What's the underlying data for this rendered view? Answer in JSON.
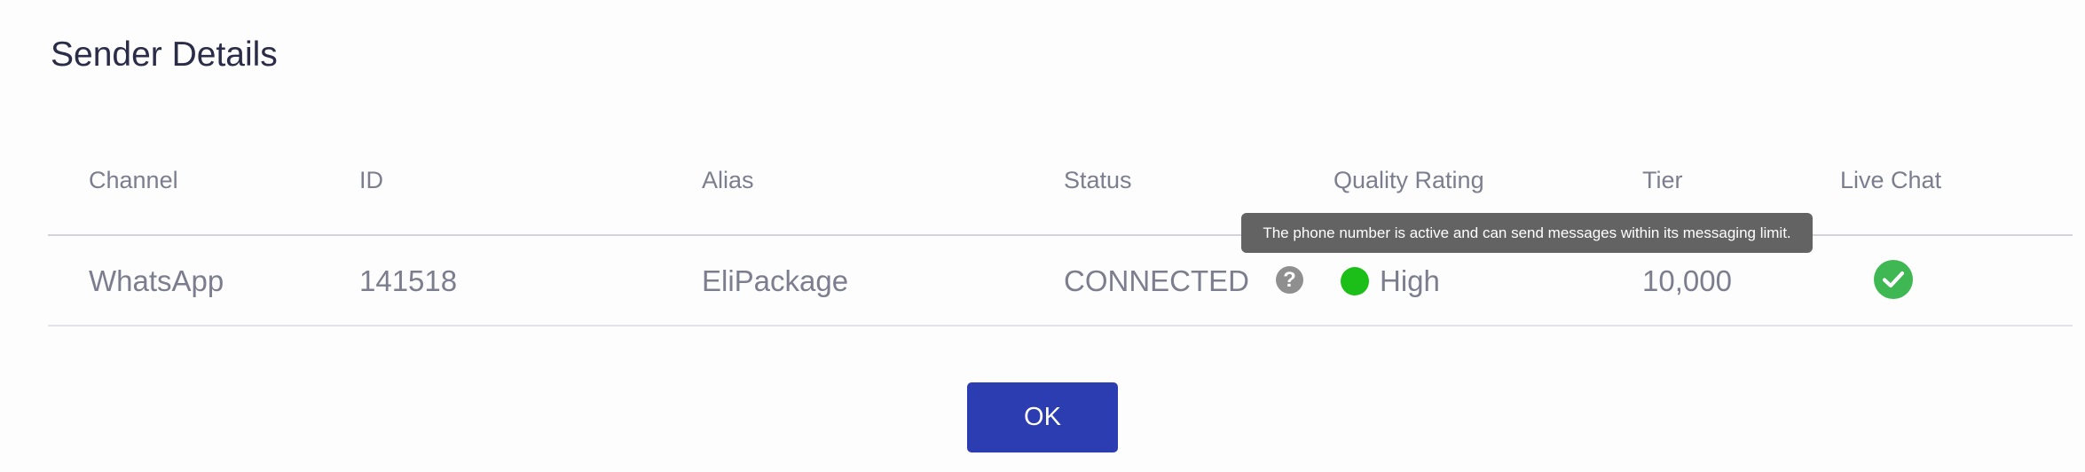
{
  "dialog": {
    "title": "Sender Details"
  },
  "table": {
    "columns": [
      "Channel",
      "ID",
      "Alias",
      "Status",
      "Quality Rating",
      "Tier",
      "Live Chat"
    ],
    "rows": [
      {
        "channel": "WhatsApp",
        "id": "141518",
        "alias": "EliPackage",
        "status": "CONNECTED",
        "status_help_icon": "?",
        "quality_rating": "High",
        "quality_color": "#1cbf17",
        "tier": "10,000",
        "live_chat_icon": "check-circle-icon",
        "live_chat_color": "#3fb853"
      }
    ]
  },
  "tooltip": {
    "text": "The phone number is active and can send messages within its messaging limit."
  },
  "actions": {
    "ok_label": "OK",
    "ok_color": "#2c3db1"
  }
}
